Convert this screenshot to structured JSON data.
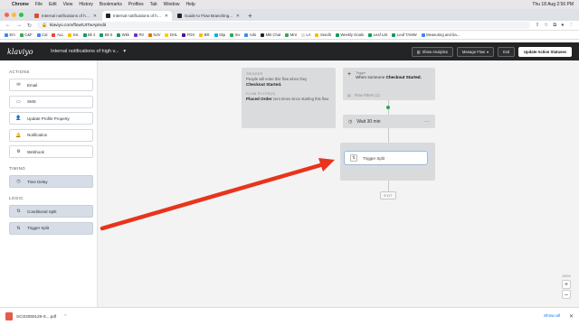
{
  "menubar": {
    "apple": "",
    "app": "Chrome",
    "items": [
      "File",
      "Edit",
      "View",
      "History",
      "Bookmarks",
      "Profiles",
      "Tab",
      "Window",
      "Help"
    ],
    "datetime": "Thu 18 Aug 2:56 PM"
  },
  "tabs": [
    {
      "label": "Internal notifications of high v..."
    },
    {
      "label": "Internal notifications of high v..."
    },
    {
      "label": "Guide to Flow Branching – Kla..."
    }
  ],
  "address": {
    "url": "klaviyo.com/flow/UtTwAp/edit"
  },
  "bookmarks": [
    {
      "label": "Em",
      "color": "#4285f4"
    },
    {
      "label": "C&F",
      "color": "#34a853"
    },
    {
      "label": "Cal",
      "color": "#4285f4"
    },
    {
      "label": "ALL",
      "color": "#ea4335"
    },
    {
      "label": "Ins",
      "color": "#fbbc04"
    },
    {
      "label": "Bk 4",
      "color": "#0f9d58"
    },
    {
      "label": "Bk 5",
      "color": "#0f9d58"
    },
    {
      "label": "Wkk",
      "color": "#0f9d58"
    },
    {
      "label": "Rtr",
      "color": "#673ab7"
    },
    {
      "label": "NJV",
      "color": "#e37400"
    },
    {
      "label": "DHL",
      "color": "#ffcc00"
    },
    {
      "label": "FDX",
      "color": "#4d148c"
    },
    {
      "label": "BR",
      "color": "#fbbc04"
    },
    {
      "label": "Skp",
      "color": "#00aff0"
    },
    {
      "label": "Inv",
      "color": "#34a853"
    },
    {
      "label": "Ads",
      "color": "#4285f4"
    },
    {
      "label": "Mkt Chat",
      "color": "#222222"
    },
    {
      "label": "Mnt",
      "color": "#34a853"
    },
    {
      "label": "LA",
      "color": "#e0e0e0"
    },
    {
      "label": "Sendit",
      "color": "#fbbc04"
    },
    {
      "label": "Weekly Goals",
      "color": "#0f9d58"
    },
    {
      "label": "Leaf List",
      "color": "#0f9d58"
    },
    {
      "label": "Leaf TAMW",
      "color": "#0f9d58"
    },
    {
      "label": "Measuring and ba...",
      "color": "#4285f4"
    }
  ],
  "header": {
    "logo": "klaviyo",
    "flow_title": "Internal notifications of high v...",
    "show_analytics": "Show Analytics",
    "manage_flow": "Manage Flow",
    "exit": "Exit",
    "update": "Update Action Statuses"
  },
  "sidebar": {
    "actions_title": "ACTIONS",
    "actions": [
      {
        "label": "Email",
        "icon": "✉"
      },
      {
        "label": "SMS",
        "icon": "▭"
      },
      {
        "label": "Update Profile Property",
        "icon": "👤"
      },
      {
        "label": "Notification",
        "icon": "🔔"
      },
      {
        "label": "Webhook",
        "icon": "⚙"
      }
    ],
    "timing_title": "TIMING",
    "timing": [
      {
        "label": "Time Delay",
        "icon": "◷"
      }
    ],
    "logic_title": "LOGIC",
    "logic": [
      {
        "label": "Conditional Split",
        "icon": "⇅"
      },
      {
        "label": "Trigger Split",
        "icon": "⇅"
      }
    ]
  },
  "canvas": {
    "info": {
      "trigger_heading": "TRIGGER",
      "trigger_text": "People will enter this flow when they",
      "trigger_bold": "Checkout Started.",
      "filter_heading": "FLOW FILTER(S)",
      "filter_bold": "Placed Order",
      "filter_text": "zero times since starting this flow"
    },
    "trigger": {
      "heading": "Trigger",
      "text": "When someone",
      "bold": "Checkout Started.",
      "filters": "Flow Filters (1)"
    },
    "wait": {
      "label": "Wait 30 min",
      "menu": "···"
    },
    "split": {
      "label": "Trigger Split"
    },
    "exit": "EXIT",
    "zoom": {
      "level": "100%",
      "plus": "+",
      "minus": "–"
    }
  },
  "downloads": {
    "file": "SCI22050129-S....pdf",
    "show_all": "Show all",
    "close": "✕"
  },
  "colors": {
    "header_bg": "#232426",
    "annotation_arrow": "#e8341c",
    "active_dot": "#2ea44f"
  }
}
